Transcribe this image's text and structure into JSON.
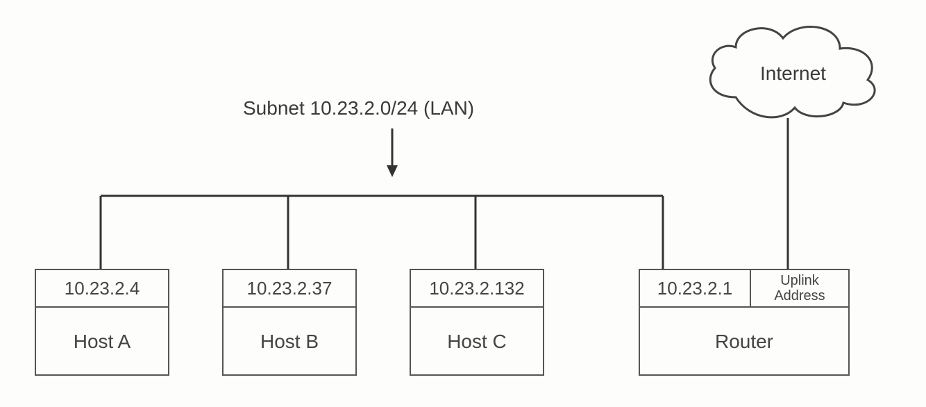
{
  "subnetLabel": "Subnet 10.23.2.0/24 (LAN)",
  "cloudLabel": "Internet",
  "hosts": {
    "a": {
      "ip": "10.23.2.4",
      "name": "Host A"
    },
    "b": {
      "ip": "10.23.2.37",
      "name": "Host B"
    },
    "c": {
      "ip": "10.23.2.132",
      "name": "Host C"
    }
  },
  "router": {
    "ip": "10.23.2.1",
    "uplinkLine1": "Uplink",
    "uplinkLine2": "Address",
    "name": "Router"
  }
}
